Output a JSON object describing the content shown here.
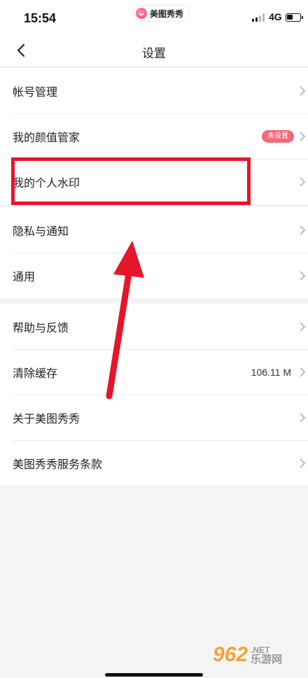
{
  "status_bar": {
    "time": "15:54",
    "app_name": "美图秀秀",
    "network": "4G"
  },
  "nav": {
    "title": "设置"
  },
  "groups": [
    {
      "items": [
        {
          "label": "帐号管理"
        },
        {
          "label": "我的颜值管家",
          "badge": "未设置"
        },
        {
          "label": "我的个人水印"
        }
      ]
    },
    {
      "items": [
        {
          "label": "隐私与通知"
        },
        {
          "label": "通用"
        }
      ]
    },
    {
      "items": [
        {
          "label": "帮助与反馈"
        },
        {
          "label": "清除缓存",
          "value": "106.11 M"
        },
        {
          "label": "关于美图秀秀"
        },
        {
          "label": "美图秀秀服务条款"
        }
      ]
    }
  ],
  "watermark": {
    "number": "962",
    "net": ".NET",
    "cn": "乐游网"
  },
  "colors": {
    "highlight": "#e5162a",
    "badge": "#f06a78",
    "background": "#f4f4f4"
  }
}
